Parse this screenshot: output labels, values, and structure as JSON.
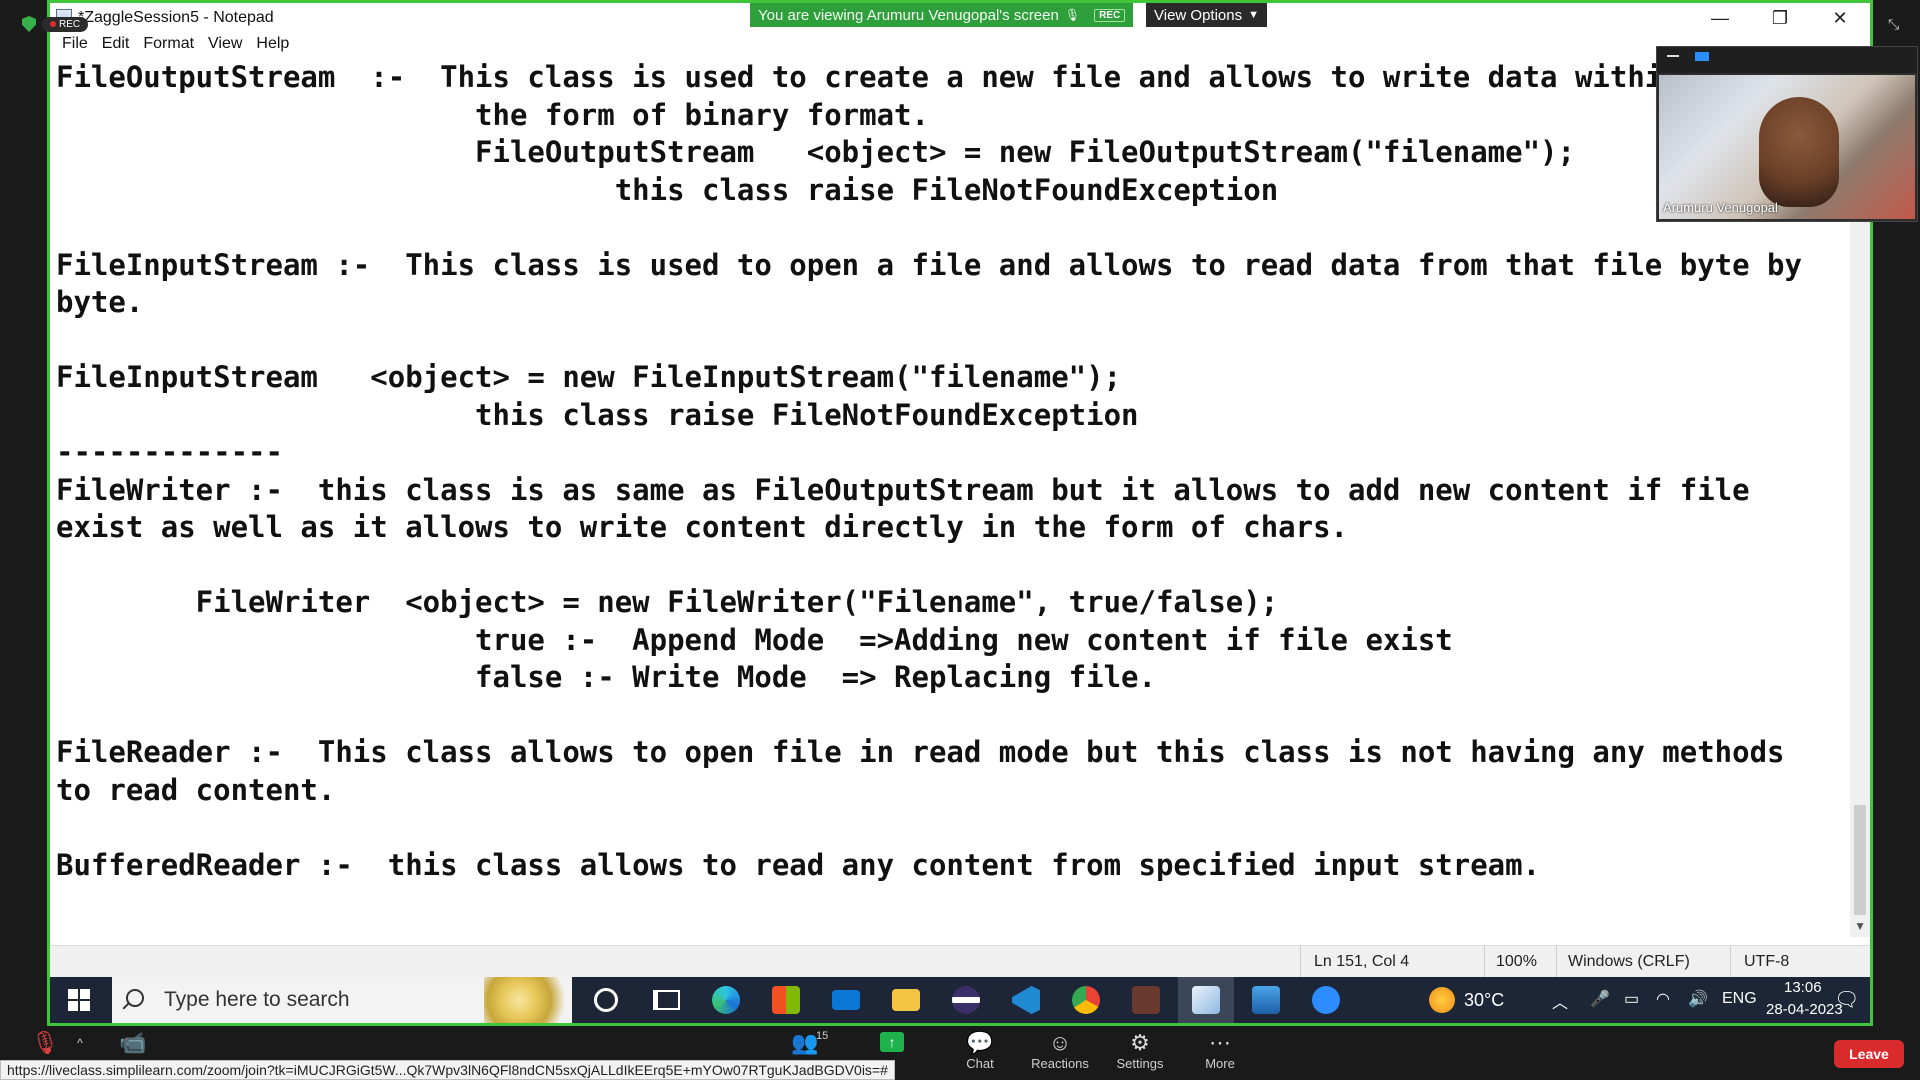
{
  "notepad": {
    "title": "*ZaggleSession5 - Notepad",
    "menu": [
      "File",
      "Edit",
      "Format",
      "View",
      "Help"
    ],
    "lines": [
      "FileOutputStream  :-  This class is used to create a new file and allows to write data withi",
      "                        the form of binary format.",
      "                        FileOutputStream   <object> = new FileOutputStream(\"filename\");",
      "                                this class raise FileNotFoundException",
      "",
      "FileInputStream :-  This class is used to open a file and allows to read data from that file byte by",
      "byte.",
      "",
      "FileInputStream   <object> = new FileInputStream(\"filename\");",
      "                        this class raise FileNotFoundException",
      "-------------",
      "FileWriter :-  this class is as same as FileOutputStream but it allows to add new content if file",
      "exist as well as it allows to write content directly in the form of chars.",
      "",
      "        FileWriter  <object> = new FileWriter(\"Filename\", true/false);",
      "                        true :-  Append Mode  =>Adding new content if file exist",
      "                        false :- Write Mode  => Replacing file.",
      "",
      "FileReader :-  This class allows to open file in read mode but this class is not having any methods",
      "to read content.",
      "",
      "BufferedReader :-  this class allows to read any content from specified input stream."
    ],
    "status": {
      "position": "Ln 151, Col 4",
      "zoom": "100%",
      "line_ending": "Windows (CRLF)",
      "encoding": "UTF-8"
    }
  },
  "zoom": {
    "rec_label": "REC",
    "share_banner": "You are viewing Arumuru Venugopal's screen",
    "banner_rec": "REC",
    "view_options": "View Options",
    "speaker_name": "Arumuru Venugopal",
    "participants_count": "15",
    "toolbar": [
      "Chat",
      "Reactions",
      "Settings",
      "More"
    ],
    "leave_label": "Leave",
    "join_url": "https://liveclass.simplilearn.com/zoom/join?tk=iMUCJRGiGt5W...Qk7Wpv3lN6QFl8ndCN5sxQjALLdIkEErq5E+mYOw07RTguKJadBGDV0is=#"
  },
  "taskbar": {
    "search_placeholder": "Type here to search",
    "weather": "30°C",
    "language": "ENG",
    "time": "13:06",
    "date": "28-04-2023",
    "apps": [
      "cortana-icon",
      "task-view-icon",
      "edge-icon",
      "store-icon",
      "mail-icon",
      "file-explorer-icon",
      "eclipse-icon",
      "vscode-icon",
      "chrome-icon",
      "game-icon",
      "notepad-icon",
      "photos-icon",
      "zoom-icon"
    ]
  }
}
